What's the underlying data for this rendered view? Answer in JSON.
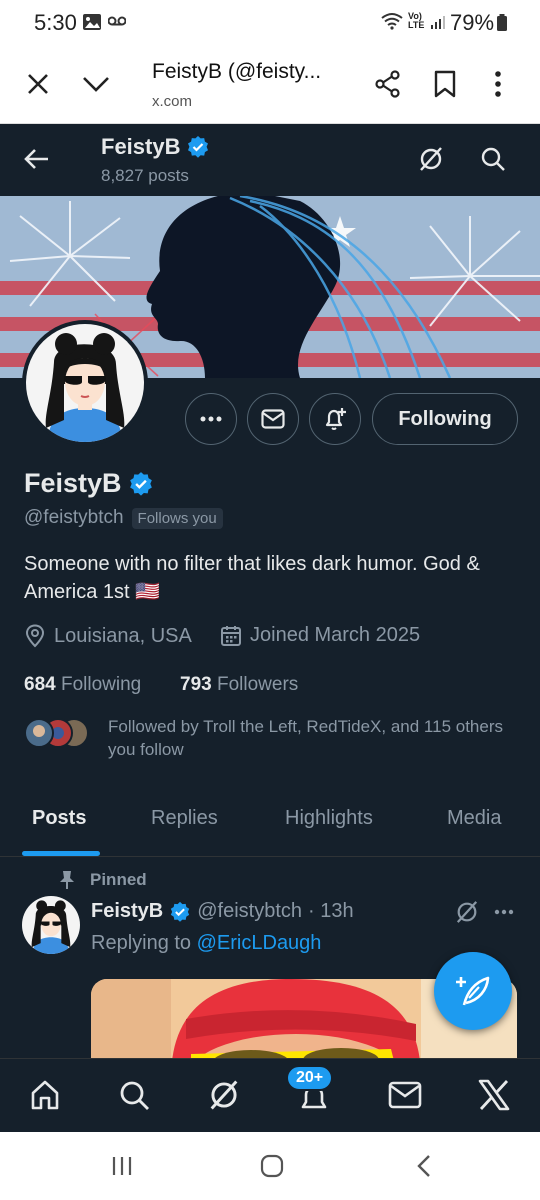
{
  "status_bar": {
    "time": "5:30",
    "battery": "79%",
    "network": "Vo) LTE"
  },
  "browser": {
    "title": "FeistyB (@feisty...",
    "url": "x.com"
  },
  "header": {
    "name": "FeistyB",
    "post_count": "8,827 posts"
  },
  "profile": {
    "name": "FeistyB",
    "handle": "@feistybtch",
    "follows_you": "Follows you",
    "bio": "Someone with no filter that likes dark humor. God & America 1st 🇺🇸",
    "location": "Louisiana, USA",
    "joined": "Joined March 2025",
    "following_count": "684",
    "following_label": "Following",
    "followers_count": "793",
    "followers_label": "Followers",
    "followed_by": "Followed by Troll the Left, RedTideX, and 115 others you follow",
    "follow_button": "Following"
  },
  "tabs": [
    {
      "label": "Posts",
      "active": true
    },
    {
      "label": "Replies",
      "active": false
    },
    {
      "label": "Highlights",
      "active": false
    },
    {
      "label": "Media",
      "active": false
    }
  ],
  "pinned_post": {
    "pinned_label": "Pinned",
    "name": "FeistyB",
    "handle": "@feistybtch",
    "time": "· 13h",
    "replying_prefix": "Replying to",
    "replying_to": "@EricLDaugh"
  },
  "bottom_nav": {
    "notification_badge": "20+"
  },
  "colors": {
    "background": "#15202b",
    "accent": "#1d9bf0",
    "text": "#e7e9ea",
    "muted": "#8b98a5"
  }
}
